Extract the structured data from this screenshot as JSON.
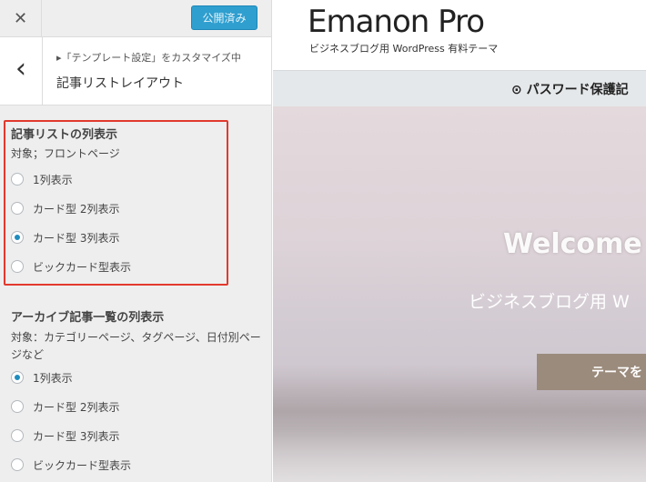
{
  "topbar": {
    "close_glyph": "✕",
    "publish_label": "公開済み"
  },
  "nav": {
    "back_glyph": "‹",
    "breadcrumb": "▸「テンプレート設定」をカスタマイズ中",
    "section_title": "記事リストレイアウト"
  },
  "groups": [
    {
      "title": "記事リストの列表示",
      "description": "対象；フロントページ",
      "options": [
        "1列表示",
        "カード型 2列表示",
        "カード型 3列表示",
        "ビックカード型表示"
      ],
      "selected": 2
    },
    {
      "title": "アーカイブ記事一覧の列表示",
      "description": "対象：カテゴリーページ、タグページ、日付別ページなど",
      "options": [
        "1列表示",
        "カード型 2列表示",
        "カード型 3列表示",
        "ビックカード型表示"
      ],
      "selected": 0
    }
  ],
  "preview": {
    "logo": "Emanon Pro",
    "tagline": "ビジネスブログ用 WordPress 有料テーマ",
    "password_bar": "⊙ パスワード保護記",
    "hero_title": "Welcome t",
    "hero_subtitle": "ビジネスブログ用 W",
    "hero_button": "テーマを"
  },
  "colors": {
    "accent": "#2f9fcf",
    "highlight_border": "#e2392d",
    "radio_selected": "#1e8cbe"
  }
}
